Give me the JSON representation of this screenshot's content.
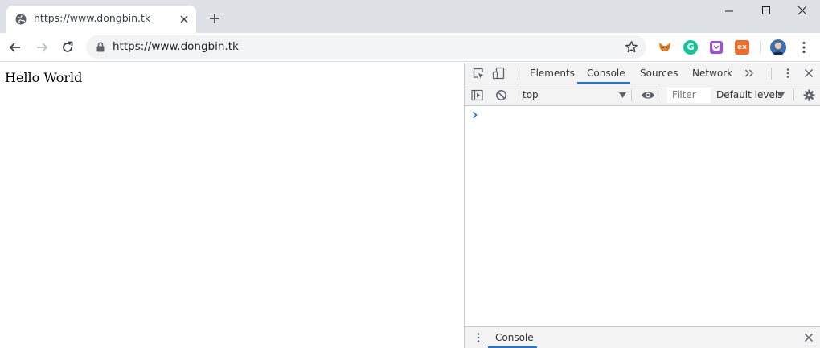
{
  "browser": {
    "tab": {
      "title": "https://www.dongbin.tk",
      "favicon": "globe-icon"
    },
    "address": {
      "url": "https://www.dongbin.tk"
    },
    "extensions": [
      "fox-extension-icon",
      "grammarly-icon",
      "pocket-icon",
      "ex-extension-icon"
    ],
    "ext_ex_label": "ex",
    "grammarly_label": "G",
    "accent": "#1a73e8"
  },
  "page": {
    "text": "Hello World"
  },
  "devtools": {
    "tabs": [
      "Elements",
      "Console",
      "Sources",
      "Network"
    ],
    "active_tab": "Console",
    "console_toolbar": {
      "context": "top",
      "filter_placeholder": "Filter",
      "levels": "Default levels"
    },
    "drawer": {
      "tab": "Console"
    }
  }
}
